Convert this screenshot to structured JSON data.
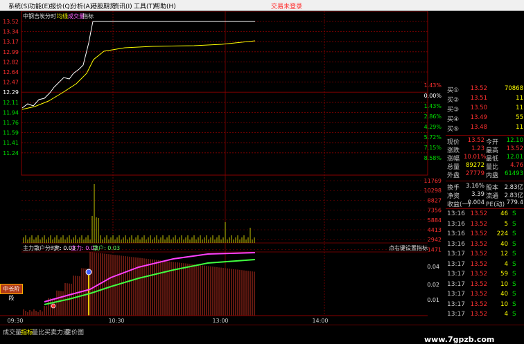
{
  "menu": [
    {
      "id": "system",
      "label": "系统(S)"
    },
    {
      "id": "function",
      "label": "功能(E)"
    },
    {
      "id": "quote",
      "label": "报价(Q)"
    },
    {
      "id": "analysis",
      "label": "分析(A)"
    },
    {
      "id": "level2",
      "label": "港股期货"
    },
    {
      "id": "info",
      "label": "资讯(I)"
    },
    {
      "id": "tools",
      "label": "工具(T)"
    },
    {
      "id": "help",
      "label": "帮助(H)"
    }
  ],
  "login_status": "交易未登录",
  "chart_header": {
    "stock": "中钢吉炭",
    "period": "分时",
    "avg": "均线",
    "volume": "成交量",
    "indicator": "指标"
  },
  "indicator_header": {
    "name": "主力散户分时",
    "tiger_label": "虎:",
    "tiger_value": "0.03",
    "main_label": "主力:",
    "main_value": "0.03",
    "retail_label": "散户:",
    "retail_value": "0.03",
    "hint": "点右键设置指标"
  },
  "time_ticks": [
    "09:30",
    "10:30",
    "13:00",
    "14:00"
  ],
  "left_price_ticks": [
    "13.52",
    "13.34",
    "13.17",
    "12.99",
    "12.82",
    "12.64",
    "12.47",
    "12.29",
    "12.11",
    "11.94",
    "11.76",
    "11.59",
    "11.41",
    "11.24"
  ],
  "right_pct_ticks": [
    "1.43%",
    "0.00%",
    "1.43%",
    "2.86%",
    "4.29%",
    "5.72%",
    "7.15%",
    "8.58%"
  ],
  "right_vol_ticks": [
    "11769",
    "10298",
    "8827",
    "7356",
    "5884",
    "4413",
    "2942",
    "1471"
  ],
  "right_ind_ticks": [
    "0.04",
    "0.02",
    "0.01"
  ],
  "hot_badge": "中长阶段",
  "quote": {
    "bids": [
      {
        "label": "买①",
        "price": "13.52",
        "vol": "70868"
      },
      {
        "label": "买②",
        "price": "13.51",
        "vol": "11"
      },
      {
        "label": "买③",
        "price": "13.50",
        "vol": "11"
      },
      {
        "label": "买④",
        "price": "13.49",
        "vol": "55"
      },
      {
        "label": "买⑤",
        "price": "13.48",
        "vol": "11"
      }
    ],
    "stats": [
      {
        "l1": "现价",
        "v1": "13.52",
        "l2": "今开",
        "v2": "12.10"
      },
      {
        "l1": "涨跌",
        "v1": "1.23",
        "l2": "最高",
        "v2": "13.52"
      },
      {
        "l1": "涨幅",
        "v1": "10.01%",
        "l2": "最低",
        "v2": "12.01"
      },
      {
        "l1": "总量",
        "v1": "89272",
        "l2": "量比",
        "v2": "4.76"
      },
      {
        "l1": "外盘",
        "v1": "27779",
        "l2": "内盘",
        "v2": "61493"
      }
    ],
    "stats2": [
      {
        "l1": "换手",
        "v1": "3.16%",
        "l2": "股本",
        "v2": "2.83亿"
      },
      {
        "l1": "净资",
        "v1": "3.39",
        "l2": "流通",
        "v2": "2.83亿"
      },
      {
        "l1": "收益(一)",
        "v1": "0.004",
        "l2": "PE(动)",
        "v2": "779.4"
      }
    ],
    "ticks": [
      {
        "time": "13:16",
        "price": "13.52",
        "vol": "46",
        "side": "S"
      },
      {
        "time": "13:16",
        "price": "13.52",
        "vol": "5",
        "side": "S"
      },
      {
        "time": "13:16",
        "price": "13.52",
        "vol": "224",
        "side": "S"
      },
      {
        "time": "13:16",
        "price": "13.52",
        "vol": "40",
        "side": "S"
      },
      {
        "time": "13:17",
        "price": "13.52",
        "vol": "12",
        "side": "S"
      },
      {
        "time": "13:17",
        "price": "13.52",
        "vol": "4",
        "side": "S"
      },
      {
        "time": "13:17",
        "price": "13.52",
        "vol": "59",
        "side": "S"
      },
      {
        "time": "13:17",
        "price": "13.52",
        "vol": "10",
        "side": "S"
      },
      {
        "time": "13:17",
        "price": "13.52",
        "vol": "40",
        "side": "S"
      },
      {
        "time": "13:17",
        "price": "13.52",
        "vol": "10",
        "side": "S"
      },
      {
        "time": "13:17",
        "price": "13.52",
        "vol": "4",
        "side": "S"
      }
    ]
  },
  "bottom_tabs": [
    {
      "id": "volume",
      "label": "成交量",
      "active": false
    },
    {
      "id": "indicator",
      "label": "指标",
      "active": true
    },
    {
      "id": "ratio",
      "label": "量比",
      "active": false
    },
    {
      "id": "force",
      "label": "买卖力道",
      "active": false
    },
    {
      "id": "auction",
      "label": "竞价图",
      "active": false
    }
  ],
  "watermark": "www.7gpzb.com",
  "colors": {
    "grid": "#8a0000",
    "up": "#ff3030",
    "down": "#00e000",
    "price": "#ffffff",
    "avg": "#ffff00",
    "main": "#ff40ff",
    "retail": "#40ff40",
    "bar": "#c03020"
  }
}
